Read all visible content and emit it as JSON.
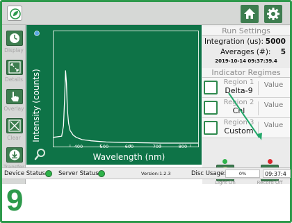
{
  "colors": {
    "accent": "#2e9a4c",
    "plot_background": "#0e7347",
    "button": "#3d7d4f",
    "led_green": "#2fb34a",
    "led_red": "#d9262c",
    "arrow": "#22a86a"
  },
  "header": {
    "logo_icon": "leaf-logo-icon",
    "home_icon": "home-icon",
    "settings_icon": "gear-icon"
  },
  "sidebar": {
    "items": [
      {
        "label": "Display",
        "icon": "clock-icon"
      },
      {
        "label": "Details",
        "icon": "expand-icon"
      },
      {
        "label": "Overlay",
        "icon": "hand-pointer-icon"
      },
      {
        "label": "Clear",
        "icon": "clear-x-icon"
      },
      {
        "label": "Transfer",
        "icon": "download-icon"
      }
    ]
  },
  "plot": {
    "ylabel": "Intensity (counts)",
    "xlabel": "Wavelength (nm)",
    "xtick_labels": [
      "400",
      "500",
      "600",
      "700",
      "800"
    ],
    "zoom_icon": "magnifier-icon"
  },
  "chart_data": {
    "type": "line",
    "xlabel": "Wavelength (nm)",
    "ylabel": "Intensity (counts)",
    "xlim": [
      345,
      825
    ],
    "ylim": [
      0,
      1
    ],
    "x_ticks": [
      400,
      500,
      600,
      700,
      800
    ],
    "grid": false,
    "series": [
      {
        "x": [
          345,
          372,
          378,
          382,
          385,
          388,
          391,
          395,
          400,
          410,
          420,
          440,
          470,
          520,
          600,
          700,
          800,
          825
        ],
        "y": [
          0.08,
          0.09,
          0.18,
          0.42,
          0.66,
          0.55,
          0.32,
          0.2,
          0.14,
          0.1,
          0.08,
          0.06,
          0.05,
          0.04,
          0.035,
          0.03,
          0.03,
          0.03
        ]
      }
    ]
  },
  "run_settings": {
    "title": "Run Settings",
    "integration_label": "Integration (us):",
    "integration_value": "5000",
    "averages_label": "Averages (#):",
    "averages_value": "5",
    "timestamp": "2019-10-14 09:37:39.4"
  },
  "indicator_regimes": {
    "title": "Indicator Regimes",
    "regions": [
      {
        "name": "Region 1",
        "substance": "Delta-9",
        "value": "Value"
      },
      {
        "name": "Region 2",
        "substance": "Chl",
        "value": "Value"
      },
      {
        "name": "Region 3",
        "substance": "Custom",
        "value": "Value"
      }
    ]
  },
  "actions": {
    "light_on_label": "Light On",
    "light_on_icon": "lightbulb-icon",
    "record_off_label": "Record Off",
    "record_off_icon": "record-icon"
  },
  "status_bar": {
    "device_status": "Device Status",
    "server_status": "Server Status",
    "version": "Version:1.2.3",
    "disc_usage_label": "Disc Usage:",
    "disc_usage_value": "0%",
    "clock": "09:37:4"
  },
  "step_number": "9"
}
